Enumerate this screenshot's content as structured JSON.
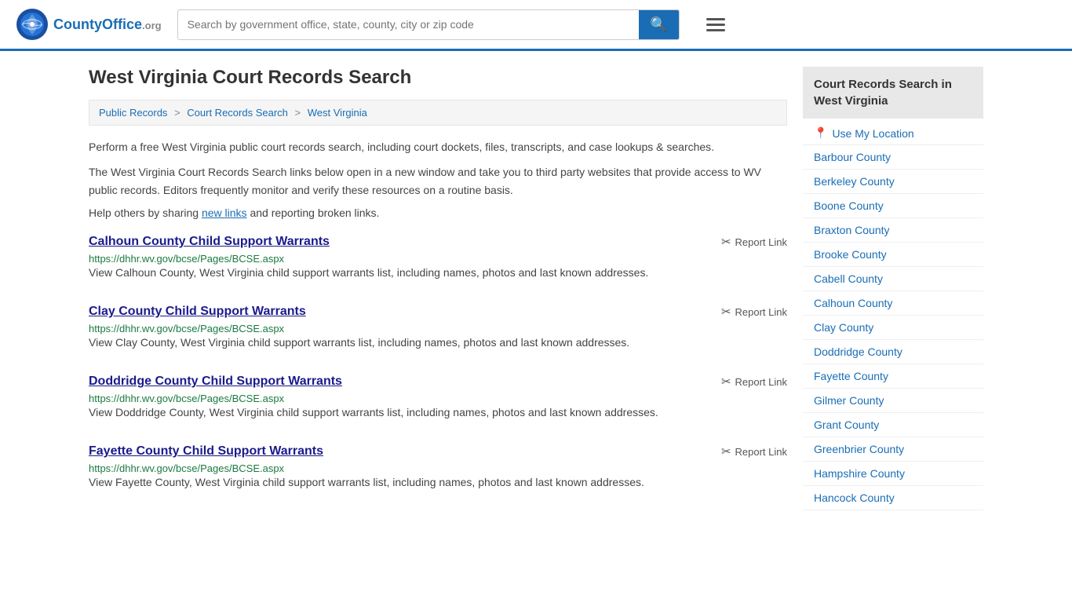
{
  "header": {
    "logo_text": "CountyOffice",
    "logo_org": ".org",
    "search_placeholder": "Search by government office, state, county, city or zip code",
    "search_value": ""
  },
  "breadcrumb": {
    "items": [
      {
        "label": "Public Records",
        "href": "#"
      },
      {
        "label": "Court Records Search",
        "href": "#"
      },
      {
        "label": "West Virginia",
        "href": "#"
      }
    ]
  },
  "page": {
    "title": "West Virginia Court Records Search",
    "intro1": "Perform a free West Virginia public court records search, including court dockets, files, transcripts, and case lookups & searches.",
    "intro2": "The West Virginia Court Records Search links below open in a new window and take you to third party websites that provide access to WV public records. Editors frequently monitor and verify these resources on a routine basis.",
    "share_text": "Help others by sharing",
    "share_link_label": "new links",
    "share_rest": " and reporting broken links."
  },
  "results": [
    {
      "title": "Calhoun County Child Support Warrants",
      "url": "https://dhhr.wv.gov/bcse/Pages/BCSE.aspx",
      "desc": "View Calhoun County, West Virginia child support warrants list, including names, photos and last known addresses.",
      "report_label": "Report Link"
    },
    {
      "title": "Clay County Child Support Warrants",
      "url": "https://dhhr.wv.gov/bcse/Pages/BCSE.aspx",
      "desc": "View Clay County, West Virginia child support warrants list, including names, photos and last known addresses.",
      "report_label": "Report Link"
    },
    {
      "title": "Doddridge County Child Support Warrants",
      "url": "https://dhhr.wv.gov/bcse/Pages/BCSE.aspx",
      "desc": "View Doddridge County, West Virginia child support warrants list, including names, photos and last known addresses.",
      "report_label": "Report Link"
    },
    {
      "title": "Fayette County Child Support Warrants",
      "url": "https://dhhr.wv.gov/bcse/Pages/BCSE.aspx",
      "desc": "View Fayette County, West Virginia child support warrants list, including names, photos and last known addresses.",
      "report_label": "Report Link"
    }
  ],
  "sidebar": {
    "title": "Court Records Search in West Virginia",
    "use_location_label": "Use My Location",
    "counties": [
      "Barbour County",
      "Berkeley County",
      "Boone County",
      "Braxton County",
      "Brooke County",
      "Cabell County",
      "Calhoun County",
      "Clay County",
      "Doddridge County",
      "Fayette County",
      "Gilmer County",
      "Grant County",
      "Greenbrier County",
      "Hampshire County",
      "Hancock County"
    ]
  }
}
